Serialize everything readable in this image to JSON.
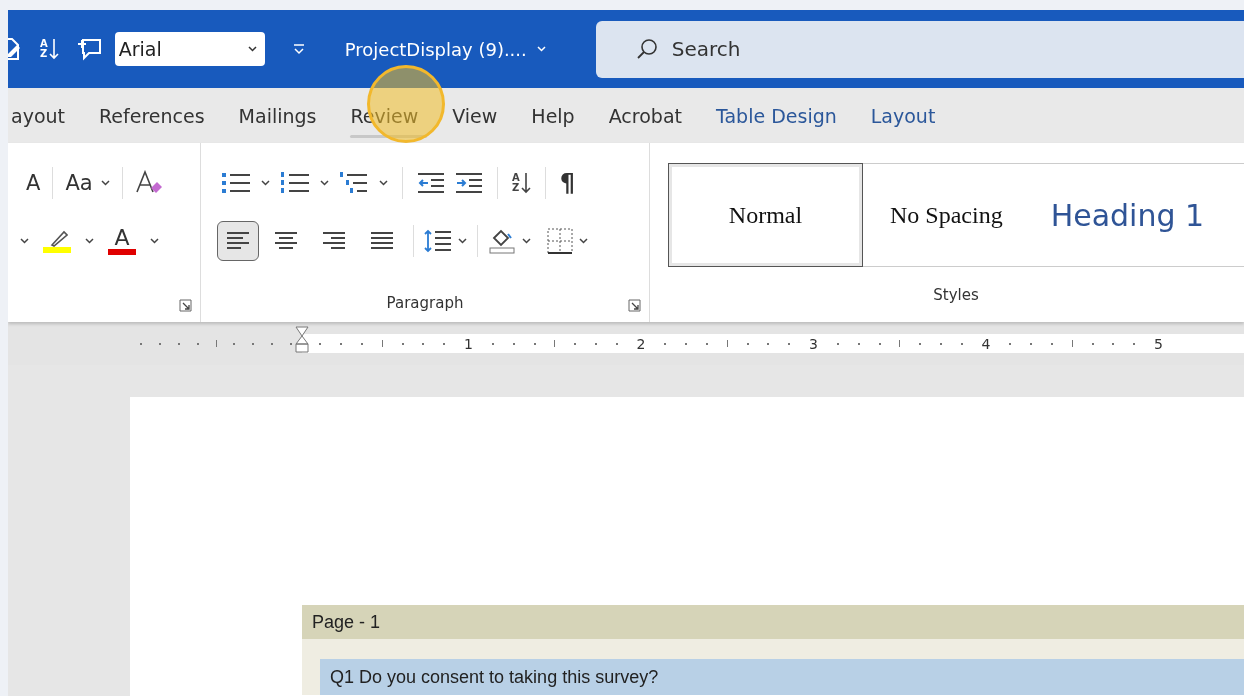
{
  "title_bar": {
    "sort": {
      "top": "A",
      "bottom": "Z"
    },
    "font": "Arial",
    "document_title": "ProjectDisplay (9)....",
    "search": {
      "placeholder": "Search"
    }
  },
  "tabs": [
    {
      "label": "ayout",
      "selected": false,
      "contextual": false
    },
    {
      "label": "References",
      "selected": false,
      "contextual": false
    },
    {
      "label": "Mailings",
      "selected": false,
      "contextual": false
    },
    {
      "label": "Review",
      "selected": true,
      "contextual": false
    },
    {
      "label": "View",
      "selected": false,
      "contextual": false
    },
    {
      "label": "Help",
      "selected": false,
      "contextual": false
    },
    {
      "label": "Acrobat",
      "selected": false,
      "contextual": false
    },
    {
      "label": "Table Design",
      "selected": false,
      "contextual": true
    },
    {
      "label": "Layout",
      "selected": false,
      "contextual": true
    }
  ],
  "ribbon": {
    "font": {
      "grow_font": "A",
      "change_case": "Aa",
      "font_color": "A"
    },
    "paragraph": {
      "label": "Paragraph",
      "sort": {
        "top": "A",
        "bottom": "Z"
      },
      "pilcrow": "¶",
      "alignment": [
        {
          "kind": "left",
          "selected": true
        },
        {
          "kind": "center",
          "selected": false
        },
        {
          "kind": "right",
          "selected": false
        },
        {
          "kind": "justify",
          "selected": false
        }
      ]
    },
    "styles": {
      "label": "Styles",
      "items": [
        {
          "label": "Normal",
          "kind": "body",
          "selected": true
        },
        {
          "label": "No Spacing",
          "kind": "body",
          "selected": false
        },
        {
          "label": "Heading 1",
          "kind": "heading",
          "selected": false
        }
      ]
    }
  },
  "ruler": {
    "numbers": [
      "1",
      "2",
      "3",
      "4",
      "5"
    ]
  },
  "document": {
    "table": {
      "page_header": "Page - 1",
      "questions": [
        "Q1 Do you consent to taking this survey?"
      ]
    }
  }
}
